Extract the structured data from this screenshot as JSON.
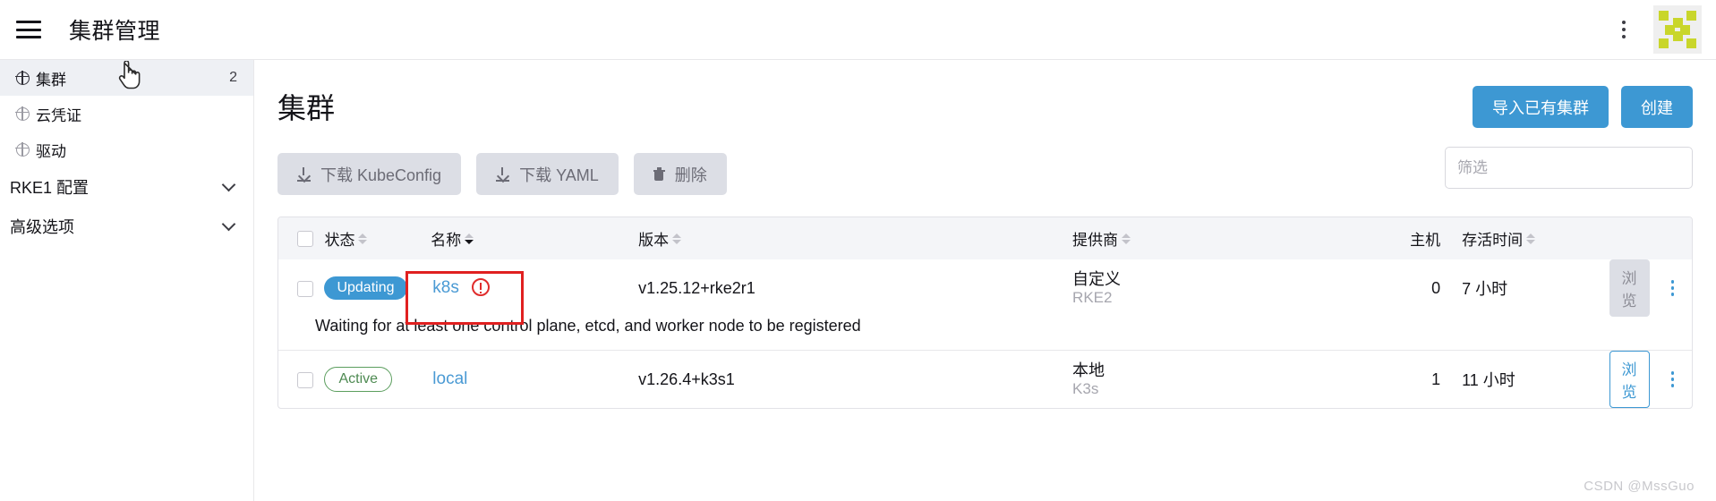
{
  "topbar": {
    "menu_icon": "hamburger-icon",
    "title": "集群管理",
    "kebab_icon": "vertical-dots-icon",
    "avatar_icon": "user-avatar-logo"
  },
  "sidebar": {
    "items": [
      {
        "label": "集群",
        "icon": "globe-icon",
        "count": "2",
        "active": true
      },
      {
        "label": "云凭证",
        "icon": "globe-icon",
        "count": "",
        "active": false
      },
      {
        "label": "驱动",
        "icon": "globe-icon",
        "count": "",
        "active": false
      }
    ],
    "groups": [
      {
        "label": "RKE1 配置",
        "icon": "chevron-down-icon"
      },
      {
        "label": "高级选项",
        "icon": "chevron-down-icon"
      }
    ]
  },
  "main": {
    "page_title": "集群",
    "actions": [
      {
        "label": "下载 KubeConfig",
        "icon": "download-icon",
        "state": "disabled"
      },
      {
        "label": "下载 YAML",
        "icon": "download-icon",
        "state": "disabled"
      },
      {
        "label": "删除",
        "icon": "trash-icon",
        "state": "disabled"
      }
    ],
    "primary_actions": [
      {
        "label": "导入已有集群"
      },
      {
        "label": "创建"
      }
    ],
    "filter": {
      "value": "",
      "placeholder": "筛选"
    }
  },
  "table": {
    "headers": [
      {
        "label": "",
        "sortable": false,
        "sort": "none"
      },
      {
        "label": "状态",
        "sortable": true,
        "sort": "none"
      },
      {
        "label": "名称",
        "sortable": true,
        "sort": "asc"
      },
      {
        "label": "版本",
        "sortable": true,
        "sort": "none"
      },
      {
        "label": "提供商",
        "sortable": true,
        "sort": "none"
      },
      {
        "label": "主机",
        "sortable": false,
        "sort": "none"
      },
      {
        "label": "存活时间",
        "sortable": true,
        "sort": "none"
      }
    ],
    "rows": [
      {
        "state": "Updating",
        "state_style": "solid-blue",
        "name": "k8s",
        "name_warning_icon": "error-circle-icon",
        "version": "v1.25.12+rke2r1",
        "provider": "自定义",
        "provider_sub": "RKE2",
        "hosts": "0",
        "age": "7 小时",
        "browse_label": "浏览",
        "browse_state": "disabled",
        "kebab_icon": "vertical-dots-icon",
        "message": "Waiting for at least one control plane, etcd, and worker node to be registered"
      },
      {
        "state": "Active",
        "state_style": "outline-green",
        "name": "local",
        "name_warning_icon": "",
        "version": "v1.26.4+k3s1",
        "provider": "本地",
        "provider_sub": "K3s",
        "hosts": "1",
        "age": "11 小时",
        "browse_label": "浏览",
        "browse_state": "enabled",
        "kebab_icon": "vertical-dots-icon",
        "message": ""
      }
    ]
  },
  "annotation": {
    "type": "red-rectangle-highlight",
    "target": "k8s-cluster-name-cell"
  },
  "watermark": "CSDN @MssGuo",
  "colors": {
    "accent_blue": "#3d98d3",
    "link_blue": "#4a9ad4",
    "active_green": "#4e8a52",
    "error_red": "#e02c2c",
    "annotation_red": "#e02020",
    "avatar_green": "#c9d62b",
    "disabled_bg": "#dcdee5",
    "sidebar_active_bg": "#eef0f4",
    "table_header_bg": "#f4f5f8"
  }
}
